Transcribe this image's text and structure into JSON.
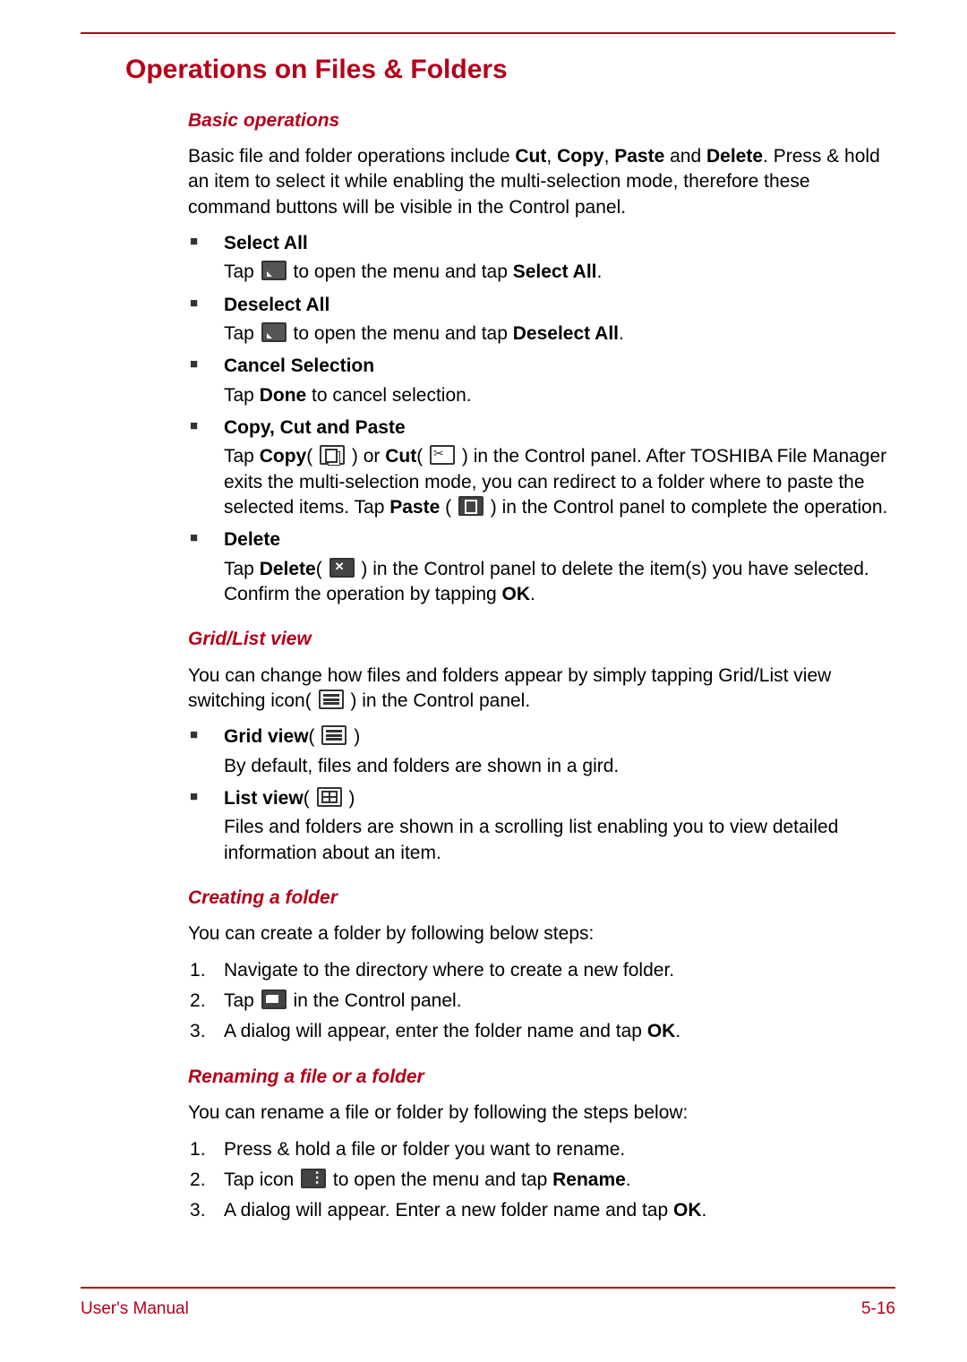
{
  "page": {
    "title": "Operations on Files & Folders",
    "footer_left": "User's Manual",
    "footer_right": "5-16"
  },
  "sections": {
    "basic": {
      "heading": "Basic operations",
      "intro_pre": "Basic file and folder operations include ",
      "intro_bold1": "Cut",
      "intro_c1": ", ",
      "intro_bold2": "Copy",
      "intro_c2": ", ",
      "intro_bold3": "Paste",
      "intro_c3": " and ",
      "intro_bold4": "Delete",
      "intro_post": ". Press & hold an item to select it while enabling the multi-selection mode, therefore these command buttons will be visible in the Control panel.",
      "items": [
        {
          "title": "Select All",
          "body_pre": "Tap ",
          "body_mid": " to open the menu and tap ",
          "body_bold": "Select All",
          "body_post": "."
        },
        {
          "title": "Deselect All",
          "body_pre": "Tap ",
          "body_mid": " to open the menu and tap ",
          "body_bold": "Deselect All",
          "body_post": "."
        },
        {
          "title": "Cancel Selection",
          "body_pre": "Tap ",
          "body_bold": "Done",
          "body_post": " to cancel selection."
        },
        {
          "title": "Copy, Cut and Paste",
          "p1a": "Tap ",
          "p1b": "Copy",
          "p1c": "( ",
          "p1d": " ) or ",
          "p1e": "Cut",
          "p1f": "( ",
          "p1g": " ) in the Control panel. After TOSHIBA File Manager exits the multi-selection mode, you can redirect to a folder where to paste the selected items. Tap ",
          "p1h": "Paste",
          "p1i": " ( ",
          "p1j": " ) in the Control panel to complete the operation."
        },
        {
          "title": "Delete",
          "d1": "Tap ",
          "d2": "Delete",
          "d3": "( ",
          "d4": " ) in the Control panel to delete the item(s) you have selected. Confirm the operation by tapping ",
          "d5": "OK",
          "d6": "."
        }
      ]
    },
    "grid": {
      "heading": "Grid/List view",
      "intro_a": "You can change how files and folders appear by simply tapping Grid/List view switching icon( ",
      "intro_b": " ) in the Control panel.",
      "items": [
        {
          "title": "Grid view",
          "paren": "( ",
          "paren2": " )",
          "body": "By default, files and folders are shown in a gird."
        },
        {
          "title": "List view",
          "paren": "( ",
          "paren2": " )",
          "body": "Files and folders are shown in a scrolling list enabling you to view detailed information about an item."
        }
      ]
    },
    "create": {
      "heading": "Creating a folder",
      "intro": "You can create a folder by following below steps:",
      "steps": {
        "s1": "Navigate to the directory where to create a new folder.",
        "s2a": "Tap ",
        "s2b": " in the Control panel.",
        "s3a": "A dialog will appear, enter the folder name and tap ",
        "s3b": "OK",
        "s3c": "."
      }
    },
    "rename": {
      "heading": "Renaming a file or a folder",
      "intro": "You can rename a file or folder by following the steps below:",
      "steps": {
        "s1": "Press & hold a file or folder you want to rename.",
        "s2a": "Tap icon ",
        "s2b": " to open the menu and tap ",
        "s2c": "Rename",
        "s2d": ".",
        "s3a": "A dialog will appear. Enter a new folder name and tap ",
        "s3b": "OK",
        "s3c": "."
      }
    }
  }
}
